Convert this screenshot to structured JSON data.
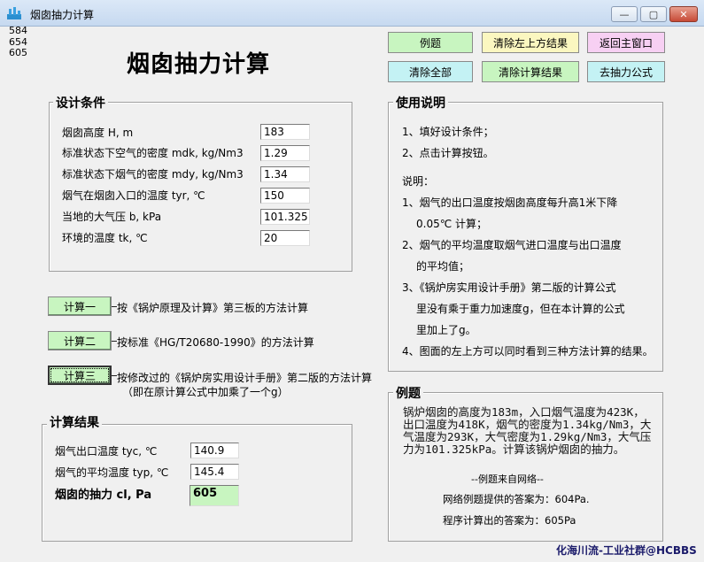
{
  "window": {
    "title": "烟囱抽力计算",
    "min_label": "—",
    "max_label": "▢",
    "close_label": "✕"
  },
  "corner_numbers": [
    "584",
    "654",
    "605"
  ],
  "heading": "烟囱抽力计算",
  "top_buttons": {
    "example": "例题",
    "clear_upper_left": "清除左上方结果",
    "back_main": "返回主窗口",
    "clear_all": "清除全部",
    "clear_calc": "清除计算结果",
    "goto_formula": "去抽力公式"
  },
  "colors": {
    "green_button": "#c8f5c0",
    "yellow_button": "#fbf7c0",
    "pink_button": "#f7d0f3",
    "cyan_button": "#c4f2f4",
    "result_highlight": "#c8f5c0"
  },
  "design": {
    "title": "设计条件",
    "rows": [
      {
        "label": "烟囱高度 H, m",
        "value": "183"
      },
      {
        "label": "标准状态下空气的密度 mdk, kg/Nm3",
        "value": "1.29"
      },
      {
        "label": "标准状态下烟气的密度 mdy, kg/Nm3",
        "value": "1.34"
      },
      {
        "label": "烟气在烟囱入口的温度 tyr, ℃",
        "value": "150"
      },
      {
        "label": "当地的大气压 b, kPa",
        "value": "101.325"
      },
      {
        "label": "环境的温度 tk, ℃",
        "value": "20"
      }
    ]
  },
  "calc_buttons": [
    {
      "label": "计算一",
      "desc": "按《锅炉原理及计算》第三板的方法计算"
    },
    {
      "label": "计算二",
      "desc": "按标准《HG/T20680-1990》的方法计算"
    },
    {
      "label": "计算三",
      "desc": "按修改过的《锅炉房实用设计手册》第二版的方法计算",
      "desc2": "（即在原计算公式中加乘了一个g）"
    }
  ],
  "results": {
    "title": "计算结果",
    "rows": [
      {
        "label": "烟气出口温度 tyc, ℃",
        "value": "140.9"
      },
      {
        "label": "烟气的平均温度 typ, ℃",
        "value": "145.4"
      }
    ],
    "draft_label": "烟囱的抽力  cl, Pa",
    "draft_value": "605"
  },
  "instructions": {
    "title": "使用说明",
    "lines": [
      "1、填好设计条件；",
      "2、点击计算按钮。",
      "说明：",
      "1、烟气的出口温度按烟囱高度每升高1米下降",
      "0.05℃ 计算；",
      "2、烟气的平均温度取烟气进口温度与出口温度",
      "的平均值；",
      "3、《锅炉房实用设计手册》第二版的计算公式",
      "里没有乘于重力加速度g，但在本计算的公式",
      "里加上了g。",
      "4、图面的左上方可以同时看到三种方法计算的结果。"
    ]
  },
  "example": {
    "title": "例题",
    "text": "    锅炉烟囱的高度为183m，入口烟气温度为423K，出口温度为418K，烟气的密度为1.34kg/Nm3，大气温度为293K，大气密度为1.29kg/Nm3，大气压力为101.325kPa。计算该锅炉烟囱的抽力。",
    "source": "--例题来自网络--",
    "net_answer": "网络例题提供的答案为：604Pa.",
    "prog_answer": "程序计算出的答案为：605Pa"
  },
  "watermark": "化海川流-工业社群@HCBBS"
}
